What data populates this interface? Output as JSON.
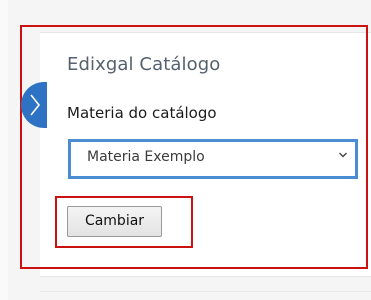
{
  "panel": {
    "title": "Edixgal Catálogo",
    "field_label": "Materia do catálogo",
    "select": {
      "selected": "Materia Exemplo"
    },
    "button_label": "Cambiar"
  },
  "icons": {
    "toggle": "chevron-right-icon",
    "select_arrow": "chevron-down-icon"
  },
  "colors": {
    "highlight": "#cc1111",
    "select_border": "#4a8dd2",
    "toggle_tab": "#2e72c4",
    "title_text": "#566170"
  }
}
